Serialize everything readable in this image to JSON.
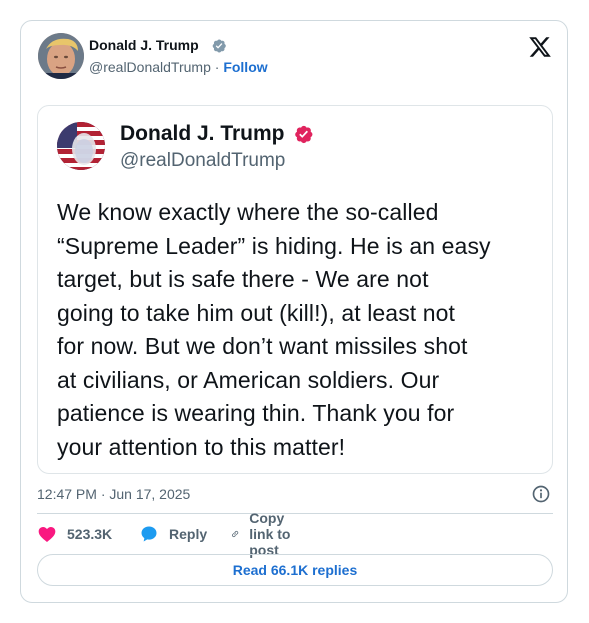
{
  "tweet": {
    "author_name": "Donald J. Trump",
    "author_handle": "@realDonaldTrump",
    "separator": "·",
    "follow_label": "Follow",
    "timestamp": "12:47 PM · Jun 17, 2025"
  },
  "quote": {
    "name": "Donald J. Trump",
    "handle": "@realDonaldTrump",
    "lines": [
      "We know exactly where the so-called",
      "“Supreme Leader” is hiding. He is an easy",
      "target, but is safe there - We are not",
      "going to take him out (kill!), at least not",
      "for now. But we don’t want missiles shot",
      "at civilians, or American soldiers. Our",
      "patience is wearing thin. Thank you for",
      "your attention to this matter!"
    ]
  },
  "actions": {
    "likes": "523.3K",
    "reply_label": "Reply",
    "copy_label": "Copy link to post"
  },
  "read_replies_label": "Read 66.1K replies",
  "colors": {
    "verified_blue": "#829aab",
    "verified_pink": "#e0245e",
    "link_blue": "#1d6fd0",
    "heart": "#f91880",
    "reply_blue": "#1d9bf0",
    "text_gray": "#536471"
  },
  "icons": [
    "x-logo-icon",
    "verified-badge-icon",
    "info-icon",
    "heart-icon",
    "reply-bubble-icon",
    "link-icon"
  ]
}
